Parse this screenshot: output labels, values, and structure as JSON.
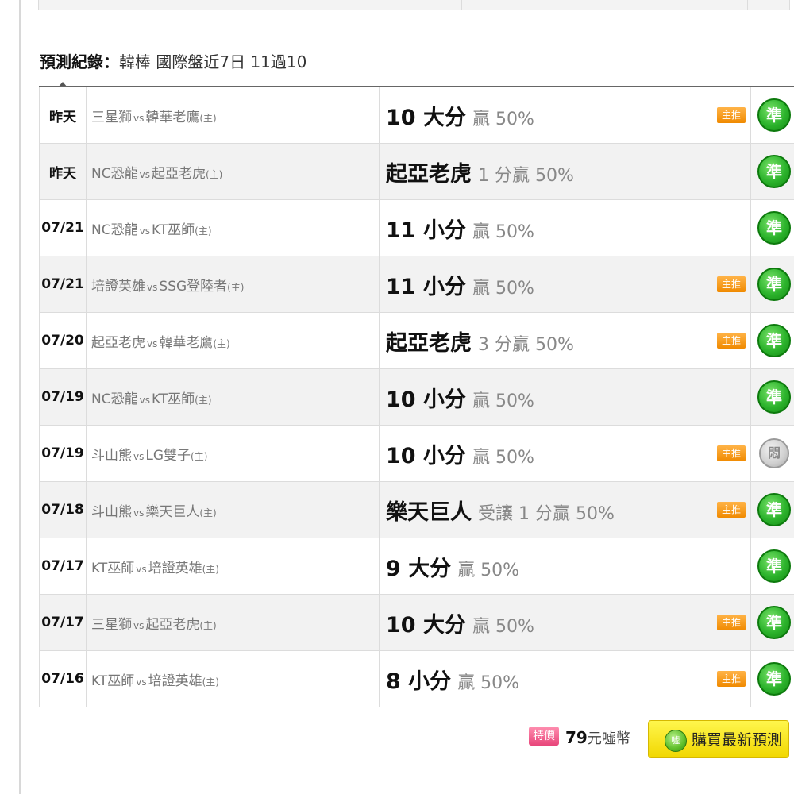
{
  "section": {
    "title": "預測紀錄：",
    "summary": "韓棒 國際盤近7日 11過10"
  },
  "records": [
    {
      "date": "昨天",
      "away": "三星獅",
      "vs": "vs",
      "home": "韓華老鷹",
      "home_tag": "(主)",
      "pick": "10 大分",
      "detail": "贏 50%",
      "push": true,
      "result": "準",
      "result_type": "hit"
    },
    {
      "date": "昨天",
      "away": "NC恐龍",
      "vs": "vs",
      "home": "起亞老虎",
      "home_tag": "(主)",
      "pick": "起亞老虎",
      "detail": "1 分贏 50%",
      "push": false,
      "result": "準",
      "result_type": "hit"
    },
    {
      "date": "07/21",
      "away": "NC恐龍",
      "vs": "vs",
      "home": "KT巫師",
      "home_tag": "(主)",
      "pick": "11 小分",
      "detail": "贏 50%",
      "push": false,
      "result": "準",
      "result_type": "hit"
    },
    {
      "date": "07/21",
      "away": "培證英雄",
      "vs": "vs",
      "home": "SSG登陸者",
      "home_tag": "(主)",
      "pick": "11 小分",
      "detail": "贏 50%",
      "push": true,
      "result": "準",
      "result_type": "hit"
    },
    {
      "date": "07/20",
      "away": "起亞老虎",
      "vs": "vs",
      "home": "韓華老鷹",
      "home_tag": "(主)",
      "pick": "起亞老虎",
      "detail": "3 分贏 50%",
      "push": true,
      "result": "準",
      "result_type": "hit"
    },
    {
      "date": "07/19",
      "away": "NC恐龍",
      "vs": "vs",
      "home": "KT巫師",
      "home_tag": "(主)",
      "pick": "10 小分",
      "detail": "贏 50%",
      "push": false,
      "result": "準",
      "result_type": "hit"
    },
    {
      "date": "07/19",
      "away": "斗山熊",
      "vs": "vs",
      "home": "LG雙子",
      "home_tag": "(主)",
      "pick": "10 小分",
      "detail": "贏 50%",
      "push": true,
      "result": "悶",
      "result_type": "push"
    },
    {
      "date": "07/18",
      "away": "斗山熊",
      "vs": "vs",
      "home": "樂天巨人",
      "home_tag": "(主)",
      "pick": "樂天巨人",
      "detail": "受讓 1 分贏 50%",
      "push": true,
      "result": "準",
      "result_type": "hit"
    },
    {
      "date": "07/17",
      "away": "KT巫師",
      "vs": "vs",
      "home": "培證英雄",
      "home_tag": "(主)",
      "pick": "9 大分",
      "detail": "贏 50%",
      "push": false,
      "result": "準",
      "result_type": "hit"
    },
    {
      "date": "07/17",
      "away": "三星獅",
      "vs": "vs",
      "home": "起亞老虎",
      "home_tag": "(主)",
      "pick": "10 大分",
      "detail": "贏 50%",
      "push": true,
      "result": "準",
      "result_type": "hit"
    },
    {
      "date": "07/16",
      "away": "KT巫師",
      "vs": "vs",
      "home": "培證英雄",
      "home_tag": "(主)",
      "pick": "8 小分",
      "detail": "贏 50%",
      "push": true,
      "result": "準",
      "result_type": "hit"
    }
  ],
  "labels": {
    "push_badge": "主推"
  },
  "footer": {
    "sale_badge": "特價",
    "price_number": "79",
    "price_unit": "元噓幣",
    "coin_icon_text": "噓",
    "buy_label": "購買最新預測"
  },
  "colors": {
    "hit": "#2cb32c",
    "push_result": "#cfcfcf",
    "push_badge": "#f08a00",
    "buy_button": "#f1d700",
    "sale_badge": "#e8457a"
  }
}
